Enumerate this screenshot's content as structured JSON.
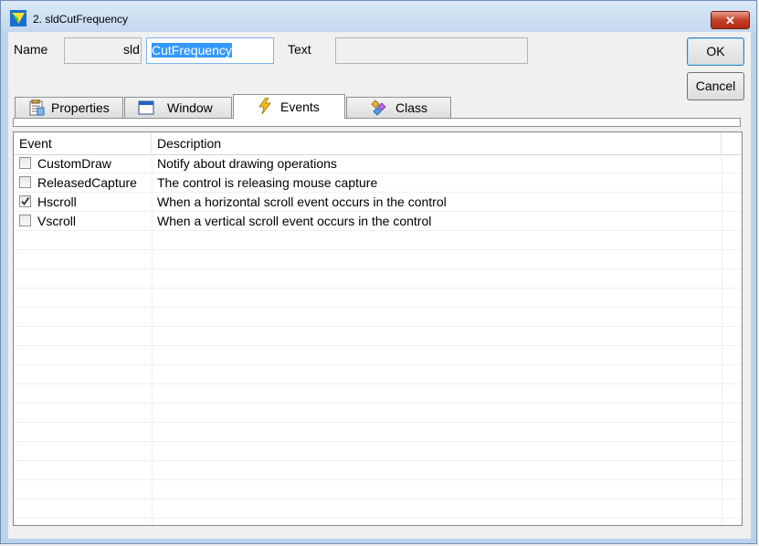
{
  "window": {
    "title": "2. sldCutFrequency",
    "close_label": "✕"
  },
  "fields": {
    "name_label": "Name",
    "name_prefix": "sld",
    "name_value": "CutFrequency",
    "text_label": "Text",
    "text_value": ""
  },
  "buttons": {
    "ok": "OK",
    "cancel": "Cancel"
  },
  "tabs": [
    {
      "label": "Properties",
      "icon": "properties-icon"
    },
    {
      "label": "Window",
      "icon": "window-icon"
    },
    {
      "label": "Events",
      "icon": "lightning-icon",
      "active": true
    },
    {
      "label": "Class",
      "icon": "class-icon"
    }
  ],
  "list": {
    "columns": [
      "Event",
      "Description"
    ],
    "rows": [
      {
        "event": "CustomDraw",
        "description": "Notify about drawing operations",
        "checked": false
      },
      {
        "event": "ReleasedCapture",
        "description": "The control is releasing mouse capture",
        "checked": false
      },
      {
        "event": "Hscroll",
        "description": "When a horizontal scroll event occurs in the control",
        "checked": true
      },
      {
        "event": "Vscroll",
        "description": "When a vertical scroll event occurs in the control",
        "checked": false
      }
    ]
  },
  "colors": {
    "accent": "#3399ff",
    "titlebar": "#c3d7ee",
    "close": "#c4402a"
  }
}
